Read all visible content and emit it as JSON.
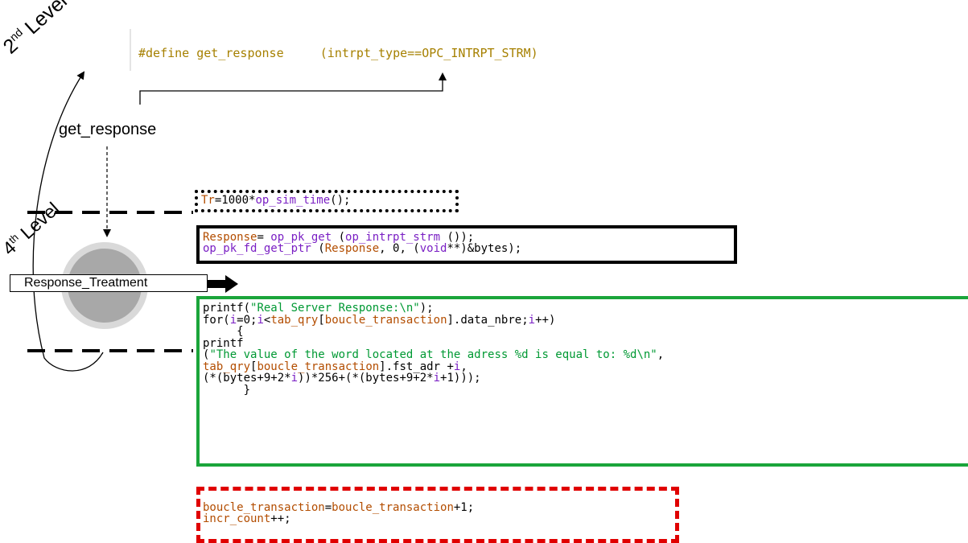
{
  "colors": {
    "keyword": "#7a1fc4",
    "variable": "#b34d00",
    "string": "#009933",
    "define": "#a68000",
    "plain": "#000000",
    "box_dotted": "#000000",
    "box_solid": "#000000",
    "box_green": "#1aa53a",
    "box_red": "#e00000",
    "node_fill": "#a8a8a8",
    "node_halo": "#d9d9d9"
  },
  "labels": {
    "level2_text": "2",
    "level2_sup": "nd",
    "level2_word": " Level",
    "level4_text": "4",
    "level4_sup": "th",
    "level4_word": " Level",
    "get_response": "get_response",
    "response_treatment": "Response_Treatment"
  },
  "define_line": {
    "parts": [
      {
        "t": "#define get_response     (intrpt_type==OPC_INTRPT_STRM)",
        "c": "define"
      }
    ]
  },
  "code_blocks": {
    "tr_block": {
      "lines": [
        [
          {
            "t": "Tr",
            "c": "variable"
          },
          {
            "t": "=1000*",
            "c": "plain"
          },
          {
            "t": "op_sim_time",
            "c": "keyword"
          },
          {
            "t": "();",
            "c": "plain"
          }
        ]
      ]
    },
    "response_block": {
      "lines": [
        [
          {
            "t": "Response",
            "c": "variable"
          },
          {
            "t": "= ",
            "c": "plain"
          },
          {
            "t": "op_pk_get",
            "c": "keyword"
          },
          {
            "t": " (",
            "c": "plain"
          },
          {
            "t": "op_intrpt_strm",
            "c": "keyword"
          },
          {
            "t": " ());",
            "c": "plain"
          }
        ],
        [
          {
            "t": "op_pk_fd_get_ptr",
            "c": "keyword"
          },
          {
            "t": " (",
            "c": "plain"
          },
          {
            "t": "Response",
            "c": "variable"
          },
          {
            "t": ", 0, (",
            "c": "plain"
          },
          {
            "t": "void",
            "c": "keyword"
          },
          {
            "t": "**)&bytes);",
            "c": "plain"
          }
        ]
      ]
    },
    "printf_block": {
      "lines": [
        [
          {
            "t": "printf(",
            "c": "plain"
          },
          {
            "t": "\"Real Server Response:\\n\"",
            "c": "string"
          },
          {
            "t": ");",
            "c": "plain"
          }
        ],
        [
          {
            "t": "for(",
            "c": "plain"
          },
          {
            "t": "i",
            "c": "keyword"
          },
          {
            "t": "=0;",
            "c": "plain"
          },
          {
            "t": "i",
            "c": "keyword"
          },
          {
            "t": "<",
            "c": "plain"
          },
          {
            "t": "tab_qry",
            "c": "variable"
          },
          {
            "t": "[",
            "c": "plain"
          },
          {
            "t": "boucle_transaction",
            "c": "variable"
          },
          {
            "t": "].data_nbre;",
            "c": "plain"
          },
          {
            "t": "i",
            "c": "keyword"
          },
          {
            "t": "++)",
            "c": "plain"
          }
        ],
        [
          {
            "t": "     {",
            "c": "plain"
          }
        ],
        [
          {
            "t": "printf",
            "c": "plain"
          }
        ],
        [
          {
            "t": "(",
            "c": "plain"
          },
          {
            "t": "\"The value of the word located at the adress %d is equal to: %d\\n\"",
            "c": "string"
          },
          {
            "t": ",",
            "c": "plain"
          }
        ],
        [
          {
            "t": "tab_qry",
            "c": "variable"
          },
          {
            "t": "[",
            "c": "plain"
          },
          {
            "t": "boucle_transaction",
            "c": "variable"
          },
          {
            "t": "].fst_adr +",
            "c": "plain"
          },
          {
            "t": "i",
            "c": "keyword"
          },
          {
            "t": ",",
            "c": "plain"
          }
        ],
        [
          {
            "t": "(*(bytes+9+2*",
            "c": "plain"
          },
          {
            "t": "i",
            "c": "keyword"
          },
          {
            "t": "))*256+(*(bytes+9+2*",
            "c": "plain"
          },
          {
            "t": "i",
            "c": "keyword"
          },
          {
            "t": "+1)));",
            "c": "plain"
          }
        ],
        [
          {
            "t": "      }",
            "c": "plain"
          }
        ]
      ]
    },
    "boucle_block": {
      "lines": [
        [
          {
            "t": "boucle_transaction",
            "c": "variable"
          },
          {
            "t": "=",
            "c": "plain"
          },
          {
            "t": "boucle_transaction",
            "c": "variable"
          },
          {
            "t": "+1;",
            "c": "plain"
          }
        ],
        [
          {
            "t": "incr_count",
            "c": "variable"
          },
          {
            "t": "++;",
            "c": "plain"
          }
        ]
      ]
    }
  }
}
